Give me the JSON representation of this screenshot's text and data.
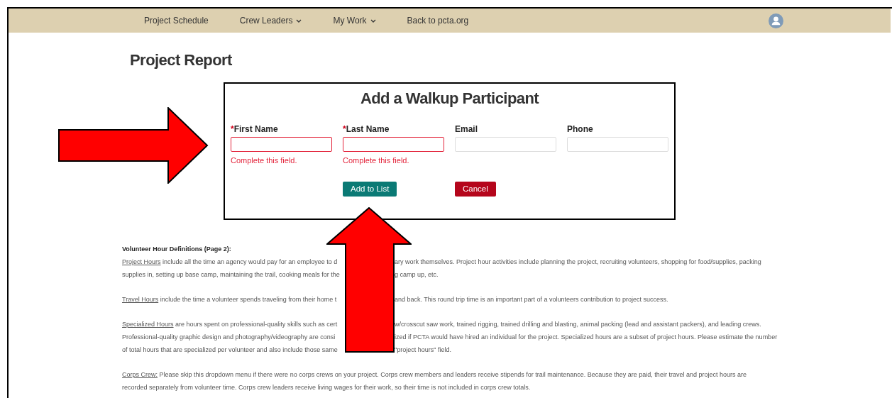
{
  "nav": {
    "items": [
      {
        "label": "Project Schedule",
        "dropdown": false
      },
      {
        "label": "Crew Leaders",
        "dropdown": true
      },
      {
        "label": "My Work",
        "dropdown": true
      },
      {
        "label": "Back to pcta.org",
        "dropdown": false
      }
    ]
  },
  "page_title": "Project Report",
  "dialog": {
    "title": "Add a Walkup Participant",
    "fields": [
      {
        "label": "First Name",
        "required": true,
        "error": "Complete this field."
      },
      {
        "label": "Last Name",
        "required": true,
        "error": "Complete this field."
      },
      {
        "label": "Email",
        "required": false
      },
      {
        "label": "Phone",
        "required": false
      }
    ],
    "required_mark": "*",
    "buttons": [
      {
        "label": "Add to List",
        "kind": "primary"
      },
      {
        "label": "Cancel",
        "kind": "danger"
      }
    ]
  },
  "definitions": {
    "title": "Volunteer Hour Definitions (Page 2):",
    "paragraphs": [
      {
        "term": "Project Hours",
        "lines": [
          {
            "kind": "split",
            "left": "include all the time an agency would pay for an employee to d",
            "right": "ary work themselves. Project hour activities include planning the project, recruiting volunteers, shopping for food/supplies, packing"
          },
          {
            "kind": "split",
            "left": "supplies in, setting up base camp, maintaining the trail, cooking meals for the",
            "right": "g camp up, etc."
          }
        ]
      },
      {
        "term": "Travel Hours",
        "lines": [
          {
            "kind": "split",
            "left": "include the time a volunteer spends traveling from their home t",
            "right": "and back. This round trip time is an important part of a volunteers contribution to project success."
          }
        ]
      },
      {
        "term": "Specialized Hours",
        "lines": [
          {
            "kind": "split",
            "left": "are hours spent on professional-quality skills such as cert",
            "right": "w/crosscut saw work, trained rigging, trained drilling and blasting, animal packing (lead and assistant packers), and leading crews."
          },
          {
            "kind": "split",
            "left": "Professional-quality graphic design and photography/videography are consi",
            "right": "ized if PCTA would have hired an individual for the project. Specialized hours are a subset of project hours. Please estimate the number"
          },
          {
            "kind": "split",
            "left": "of total hours that are specialized per volunteer and also include those same",
            "right": "\"project hours\" field."
          }
        ]
      },
      {
        "term": "Corps Crew:",
        "lines": [
          {
            "kind": "full",
            "text": "Please skip this dropdown menu if there were no corps crews on your project. Corps crew members and leaders receive stipends for trail maintenance. Because they are paid, their travel and project hours are"
          },
          {
            "kind": "full",
            "text": "recorded separately from volunteer time. Corps crew leaders receive living wages for their work, so their time is not included in corps crew totals."
          }
        ]
      }
    ]
  }
}
